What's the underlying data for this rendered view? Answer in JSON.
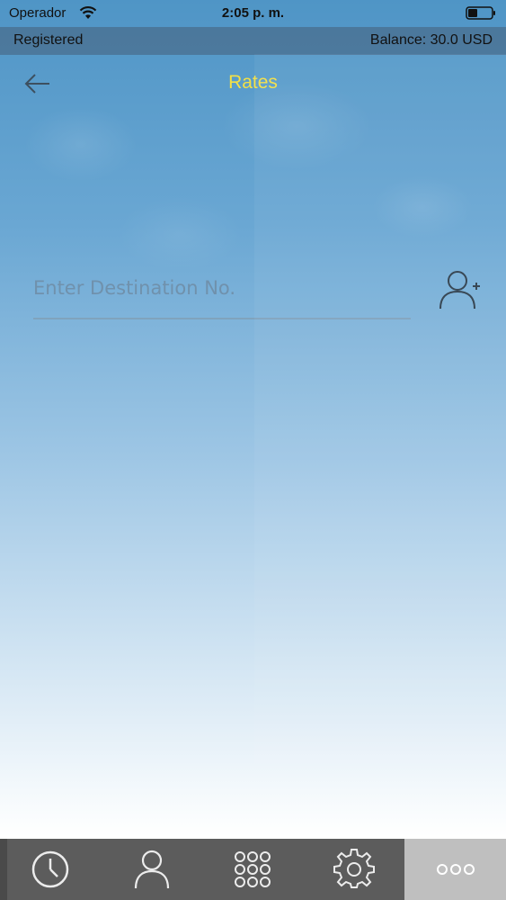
{
  "status_bar": {
    "carrier": "Operador",
    "time": "2:05 p. m."
  },
  "account_bar": {
    "registration_status": "Registered",
    "balance": "Balance: 30.0 USD"
  },
  "header": {
    "title": "Rates",
    "title_color": "#f3e046"
  },
  "destination": {
    "placeholder": "Enter Destination No.",
    "value": ""
  },
  "tab_bar": {
    "tabs": [
      {
        "icon": "clock-icon",
        "active": false
      },
      {
        "icon": "contact-icon",
        "active": false
      },
      {
        "icon": "keypad-icon",
        "active": false
      },
      {
        "icon": "gear-icon",
        "active": false
      },
      {
        "icon": "more-icon",
        "active": true
      }
    ],
    "background": "#5c5c5c",
    "active_background": "#bfbfbf"
  }
}
